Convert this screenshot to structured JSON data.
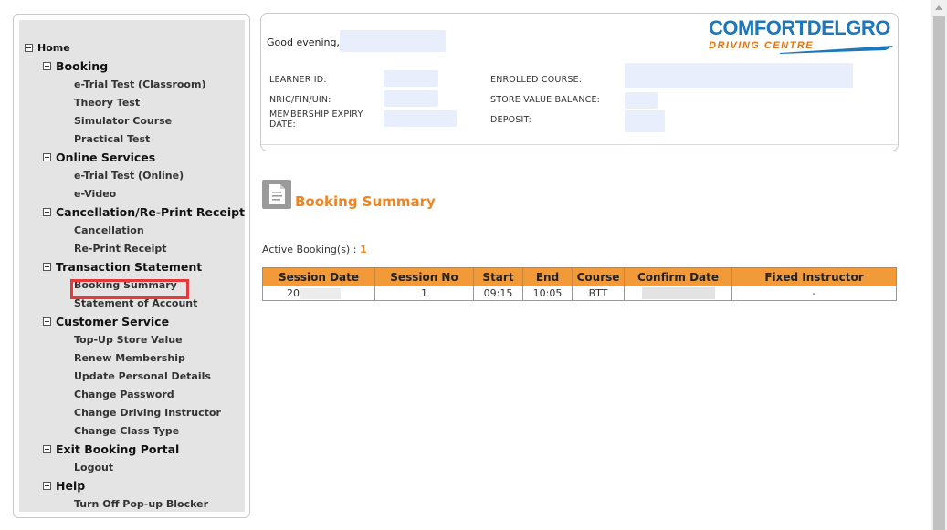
{
  "nav": {
    "home": "Home",
    "sections": [
      {
        "label": "Booking",
        "items": [
          "e-Trial Test (Classroom)",
          "Theory Test",
          "Simulator Course",
          "Practical Test"
        ]
      },
      {
        "label": "Online Services",
        "items": [
          "e-Trial Test (Online)",
          "e-Video"
        ]
      },
      {
        "label": "Cancellation/Re-Print Receipt",
        "items": [
          "Cancellation",
          "Re-Print Receipt"
        ]
      },
      {
        "label": "Transaction Statement",
        "items": [
          "Booking Summary",
          "Statement of Account"
        ]
      },
      {
        "label": "Customer Service",
        "items": [
          "Top-Up Store Value",
          "Renew Membership",
          "Update Personal Details",
          "Change Password",
          "Change Driving Instructor",
          "Change Class Type"
        ]
      },
      {
        "label": "Exit Booking Portal",
        "items": [
          "Logout"
        ]
      },
      {
        "label": "Help",
        "items": [
          "Turn Off Pop-up Blocker"
        ]
      }
    ],
    "highlighted_item": "Booking Summary",
    "highlight_color": "#e5393b"
  },
  "header": {
    "greeting": "Good evening,",
    "labels": {
      "learner_id": "LEARNER ID:",
      "nric": "NRIC/FIN/UIN:",
      "membership_expiry": "MEMBERSHIP EXPIRY DATE:",
      "enrolled_course": "ENROLLED COURSE:",
      "store_value_balance": "STORE VALUE BALANCE:",
      "deposit": "DEPOSIT:"
    },
    "logo": {
      "top": "COMFORTDELGRO",
      "bottom": "DRIVING CENTRE",
      "top_color": "#1c77bd",
      "bottom_color": "#e8730f"
    }
  },
  "summary": {
    "title": "Booking Summary",
    "active_label": "Active Booking(s) :",
    "active_count": "1",
    "accent_color": "#ef8421",
    "icon": "document-icon",
    "columns": [
      "Session Date",
      "Session No",
      "Start",
      "End",
      "Course",
      "Confirm Date",
      "Fixed Instructor"
    ],
    "rows": [
      {
        "session_date_prefix": "20",
        "session_no": "1",
        "start": "09:15",
        "end": "10:05",
        "course": "BTT",
        "fixed_instructor": "-"
      }
    ],
    "header_color": "#f29a3a"
  }
}
